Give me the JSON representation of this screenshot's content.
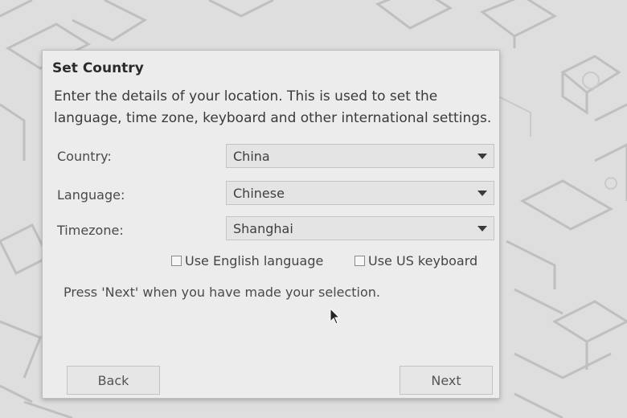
{
  "dialog": {
    "title": "Set Country",
    "intro": "Enter the details of your location. This is used to set the language, time zone, keyboard and other international settings.",
    "fields": [
      {
        "label": "Country:",
        "value": "China"
      },
      {
        "label": "Language:",
        "value": "Chinese"
      },
      {
        "label": "Timezone:",
        "value": "Shanghai"
      }
    ],
    "checkboxes": [
      {
        "label": "Use English language",
        "checked": false
      },
      {
        "label": "Use US keyboard",
        "checked": false
      }
    ],
    "hint": "Press 'Next' when you have made your selection.",
    "back_label": "Back",
    "next_label": "Next"
  }
}
